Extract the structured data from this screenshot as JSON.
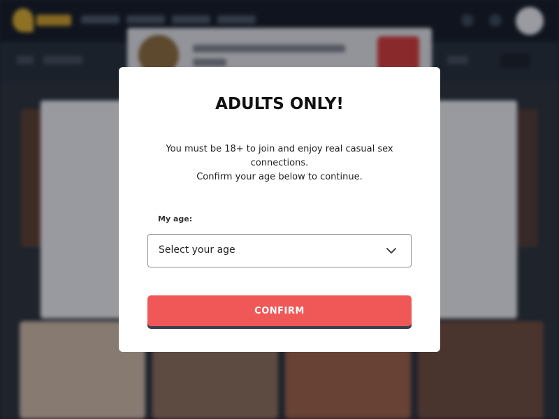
{
  "modal": {
    "title": "ADULTS ONLY!",
    "text_line1": "You must be 18+ to join and enjoy real casual sex",
    "text_line2": "connections.",
    "text_line3": "Confirm your age below to continue.",
    "age_label": "My age:",
    "age_select_value": "Select your age",
    "confirm_label": "CONFIRM"
  },
  "colors": {
    "confirm_button": "#f05858",
    "confirm_shadow": "#3a3f52",
    "modal_background": "#ffffff",
    "page_background": "#1d2430"
  },
  "icons": {
    "select_chevron": "chevron-down-icon"
  }
}
